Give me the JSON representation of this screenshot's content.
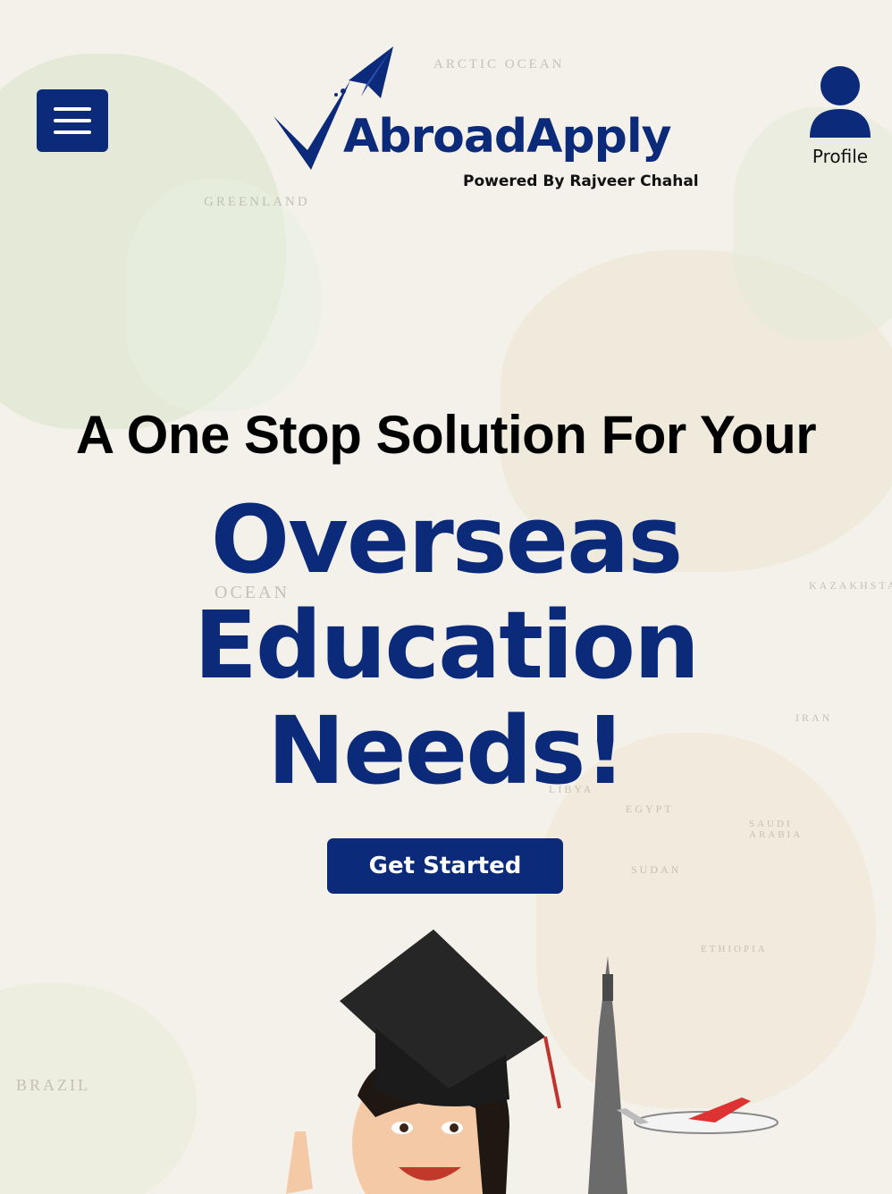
{
  "header": {
    "menu_icon": "hamburger-menu-icon",
    "logo": {
      "name": "AbroadApply",
      "tagline": "Powered By Rajveer Chahal"
    },
    "profile": {
      "icon": "user-icon",
      "label": "Profile"
    }
  },
  "hero": {
    "tagline": "A One Stop Solution For Your",
    "headline": [
      "Overseas",
      "Education",
      "Needs!"
    ],
    "cta_label": "Get Started"
  },
  "background": {
    "map_labels": [
      "ARCTIC OCEAN",
      "GREENLAND",
      "OCEAN",
      "BRAZIL",
      "KAZAKHSTAN",
      "SAUDI ARABIA",
      "SUDAN",
      "ETHIOPIA",
      "EGYPT",
      "LIBYA",
      "IRAN"
    ]
  },
  "colors": {
    "brand": "#0c2a7a",
    "text": "#000000",
    "background": "#f3f1ea"
  }
}
